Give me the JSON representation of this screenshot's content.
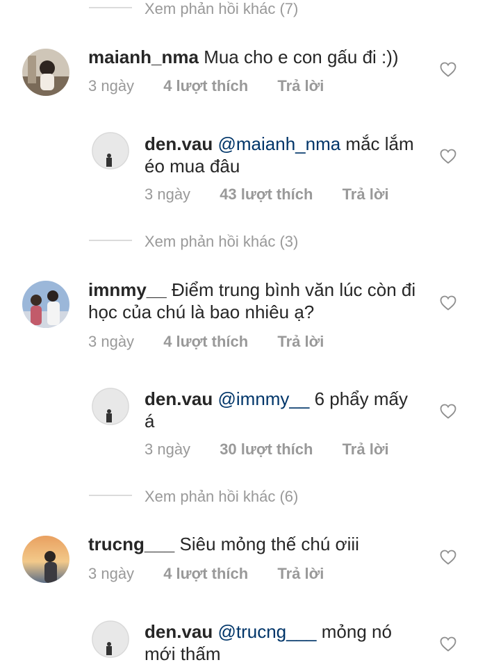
{
  "thread": {
    "more_replies_top": "Xem phản hồi khác (7)",
    "more_replies_2": "Xem phản hồi khác (3)",
    "more_replies_3": "Xem phản hồi khác (6)",
    "reply_label": "Trả lời",
    "comments": [
      {
        "username": "maianh_nma",
        "text": "Mua cho e con gấu đi :))",
        "time": "3 ngày",
        "likes": "4 lượt thích",
        "reply": {
          "username": "den.vau",
          "mention": "@maianh_nma",
          "text": " mắc lắm éo mua đâu",
          "time": "3 ngày",
          "likes": "43 lượt thích"
        }
      },
      {
        "username": "imnmy__",
        "text": "Điểm trung bình văn lúc còn đi học của chú là bao nhiêu ạ?",
        "time": "3 ngày",
        "likes": "4 lượt thích",
        "reply": {
          "username": "den.vau",
          "mention": "@imnmy__",
          "text": " 6 phẩy mấy á",
          "time": "3 ngày",
          "likes": "30 lượt thích"
        }
      },
      {
        "username": "trucng___",
        "text": "Siêu mỏng thế chú ơiii",
        "time": "3 ngày",
        "likes": "4 lượt thích",
        "reply": {
          "username": "den.vau",
          "mention": "@trucng___",
          "text": " mỏng nó mới thấm"
        }
      }
    ]
  },
  "icons": {
    "like": "heart-outline-icon"
  },
  "colors": {
    "text": "#262626",
    "meta": "#999999",
    "mention": "#003569",
    "divider": "#dbdbdb"
  }
}
